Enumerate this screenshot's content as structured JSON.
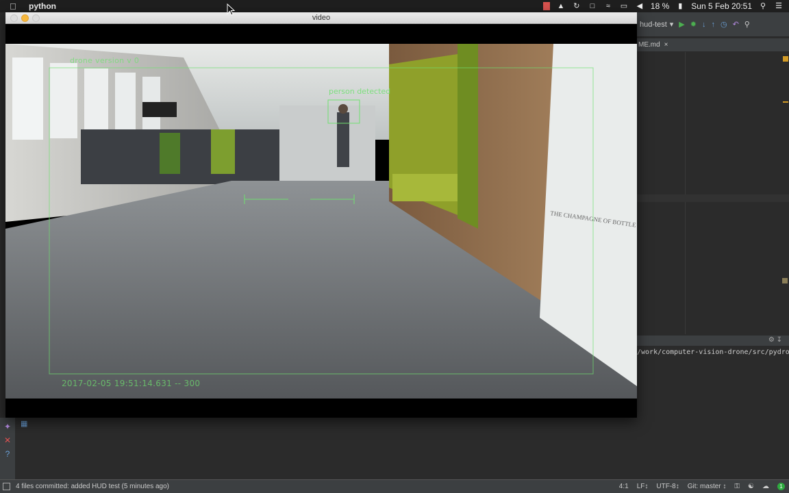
{
  "menubar": {
    "app_name": "python",
    "battery": "18 %",
    "datetime": "Sun 5 Feb  20:51"
  },
  "video_window": {
    "title": "video",
    "hud": {
      "version_text": "drone version v 0",
      "detection_label": "person detected",
      "timestamp_text": "2017-02-05 19:51:14.631 -- 300"
    },
    "scene_sign_text": "THE CHAMPAGNE OF BOTTLE B"
  },
  "ide": {
    "run_config": "hud-test",
    "editor_tab": "ME.md",
    "run_output_path": "/work/computer-vision-drone/src/pydrone/",
    "status_message": "4 files committed: added HUD test (5 minutes ago)",
    "status_position": "4:1",
    "status_line_sep": "LF↕",
    "status_encoding": "UTF-8↕",
    "status_vcs": "Git: master ↕"
  },
  "colors": {
    "hud_green": "#6fe06f",
    "ide_bg": "#2b2b2b",
    "ide_panel": "#3c3f41"
  }
}
